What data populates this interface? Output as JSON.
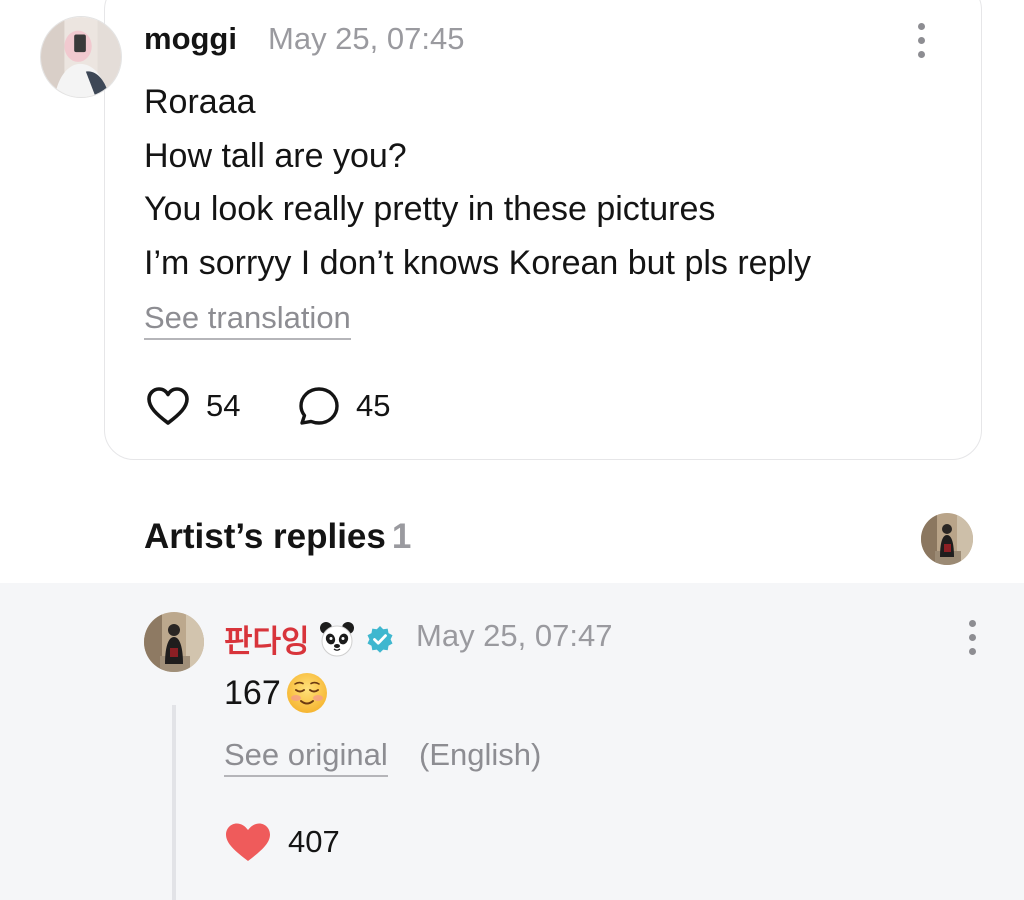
{
  "comment": {
    "username": "moggi",
    "timestamp": "May 25, 07:45",
    "lines": [
      "Roraaa",
      "How tall are you?",
      "You look really pretty in these pictures",
      "I’m sorryy I don’t knows Korean but pls reply"
    ],
    "see_translation": "See translation",
    "likes": "54",
    "replies": "45",
    "icons": {
      "like": "heart-outline-icon",
      "reply": "speech-bubble-icon",
      "menu": "more-vertical-icon"
    }
  },
  "artist_replies": {
    "title": "Artist’s replies",
    "count": "1"
  },
  "reply": {
    "username": "판다잉",
    "name_emoji_icon": "panda-face-icon",
    "verified_icon": "verified-badge-icon",
    "timestamp": "May 25, 07:47",
    "text": "167",
    "text_emoji_icon": "smiling-face-icon",
    "see_original": "See original",
    "language_note": "(English)",
    "likes": "407",
    "icons": {
      "like": "heart-filled-icon",
      "menu": "more-vertical-icon"
    }
  },
  "colors": {
    "artist_name": "#d8343b",
    "heart_filled": "#ef5b5b",
    "verified": "#3fb7cf",
    "muted_text": "#9a9a9f",
    "panel_bg": "#f5f6f8"
  }
}
